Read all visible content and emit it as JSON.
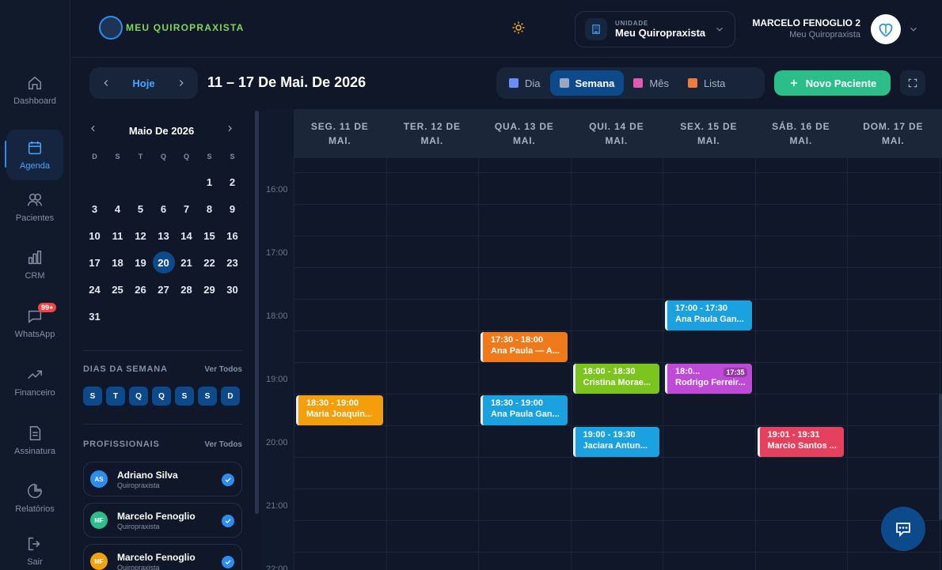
{
  "app": {
    "logo_text": "MEU QUIROPRAXISTA"
  },
  "rail": {
    "items": [
      {
        "label": "Dashboard",
        "icon": "home-icon"
      },
      {
        "label": "Agenda",
        "icon": "calendar-icon",
        "active": true
      },
      {
        "label": "Pacientes",
        "icon": "users-icon"
      },
      {
        "label": "CRM",
        "icon": "bar-chart-icon"
      },
      {
        "label": "WhatsApp",
        "icon": "chat-icon",
        "badge": "99+"
      },
      {
        "label": "Financeiro",
        "icon": "trend-icon"
      },
      {
        "label": "Assinatura",
        "icon": "document-icon"
      },
      {
        "label": "Relatórios",
        "icon": "pie-chart-icon"
      },
      {
        "label": "Sair",
        "icon": "logout-icon"
      }
    ]
  },
  "header": {
    "unit_caption": "UNIDADE",
    "unit_name": "Meu Quiropraxista",
    "user_name": "MARCELO FENOGLIO 2",
    "user_sub": "Meu Quiropraxista"
  },
  "toolbar": {
    "today_label": "Hoje",
    "range_title": "11 – 17 De Mai. De 2026",
    "views": [
      {
        "label": "Dia",
        "color": "#6b8cff"
      },
      {
        "label": "Semana",
        "color": "#9aa7bd",
        "active": true
      },
      {
        "label": "Mês",
        "color": "#e05ab0"
      },
      {
        "label": "Lista",
        "color": "#f07a3a"
      }
    ],
    "new_button_label": "Novo Paciente"
  },
  "mini_calendar": {
    "title": "Maio De 2026",
    "weekdays": [
      "D",
      "S",
      "T",
      "Q",
      "Q",
      "S",
      "S"
    ],
    "leading_blanks": 5,
    "days": [
      "1",
      "2",
      "3",
      "4",
      "5",
      "6",
      "7",
      "8",
      "9",
      "10",
      "11",
      "12",
      "13",
      "14",
      "15",
      "16",
      "17",
      "18",
      "19",
      "20",
      "21",
      "22",
      "23",
      "24",
      "25",
      "26",
      "27",
      "28",
      "29",
      "30",
      "31"
    ],
    "selected": "20"
  },
  "weekdays_section": {
    "title": "DIAS DA SEMANA",
    "link": "Ver Todos",
    "chips": [
      "S",
      "T",
      "Q",
      "Q",
      "S",
      "S",
      "D"
    ]
  },
  "professionals_section": {
    "title": "PROFISSIONAIS",
    "link": "Ver Todos",
    "items": [
      {
        "initials": "AS",
        "name": "Adriano Silva",
        "role": "Quiropraxista",
        "color": "#2d8cf0"
      },
      {
        "initials": "MF",
        "name": "Marcelo Fenoglio",
        "role": "Quiropraxista",
        "color": "#2bbd8a"
      },
      {
        "initials": "MF",
        "name": "Marcelo Fenoglio",
        "role": "Quiropraxista",
        "color": "#f5a10d"
      }
    ]
  },
  "calendar": {
    "columns": [
      "SEG. 11 DE MAI.",
      "TER. 12 DE MAI.",
      "QUA. 13 DE MAI.",
      "QUI. 14 DE MAI.",
      "SEX. 15 DE MAI.",
      "SÁB. 16 DE MAI.",
      "DOM. 17 DE MAI."
    ],
    "hours": [
      "16:00",
      "17:00",
      "18:00",
      "19:00",
      "20:00",
      "21:00",
      "22:00"
    ],
    "events": [
      {
        "day": 4,
        "start": "17:00",
        "time": "17:00 - 17:30",
        "title": "Ana Paula Gan...",
        "color": "#1aa1e0"
      },
      {
        "day": 2,
        "start": "17:30",
        "time": "17:30 - 18:00",
        "title": "Ana Paula — A...",
        "color": "#f07a1a"
      },
      {
        "day": 3,
        "start": "18:00",
        "time": "18:00 - 18:30",
        "title": "Cristina Morae...",
        "color": "#7cc41e"
      },
      {
        "day": 4,
        "start": "18:00",
        "time": "18:0...",
        "title": "Rodrigo Ferreir...",
        "color": "#c04ad8",
        "tag": "17:35"
      },
      {
        "day": 0,
        "start": "18:30",
        "time": "18:30 - 19:00",
        "title": "Maria Joaquin...",
        "color": "#f59e0b"
      },
      {
        "day": 2,
        "start": "18:30",
        "time": "18:30 - 19:00",
        "title": "Ana Paula Gan...",
        "color": "#1aa1e0"
      },
      {
        "day": 3,
        "start": "19:00",
        "time": "19:00 - 19:30",
        "title": "Jaciara Antun...",
        "color": "#1aa1e0"
      },
      {
        "day": 5,
        "start": "19:01",
        "time": "19:01 - 19:31",
        "title": "Marcio Santos ...",
        "color": "#e5405e"
      }
    ]
  }
}
